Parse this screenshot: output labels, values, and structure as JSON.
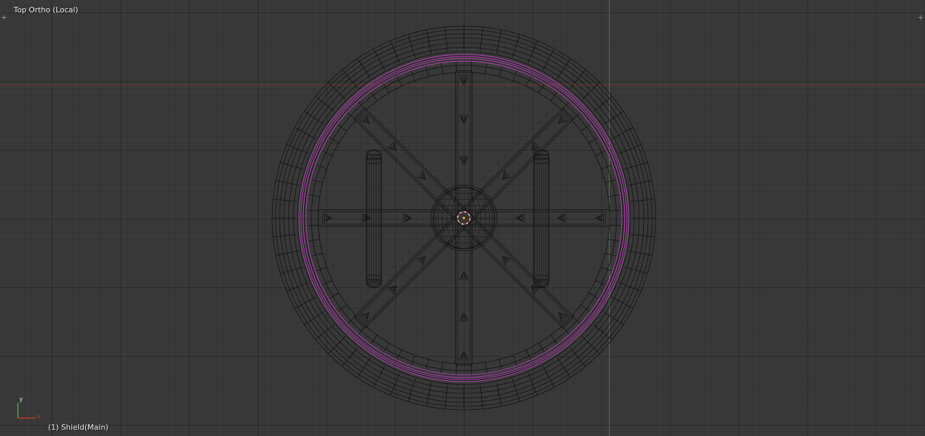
{
  "viewport": {
    "view_name": "Top Ortho (Local)",
    "active_object": "(1) Shield(Main)",
    "gizmo": {
      "y_label": "y",
      "x_label": "x"
    }
  },
  "icons": [
    "plus-icon-left",
    "plus-icon-right",
    "axes-gizmo-icon",
    "3d-cursor-icon"
  ],
  "colors": {
    "background": "#393939",
    "wire": "#111111",
    "selected_edge": "#c040c0",
    "x_axis": "#8a3a2c",
    "y_axis": "#3e8a3e"
  }
}
